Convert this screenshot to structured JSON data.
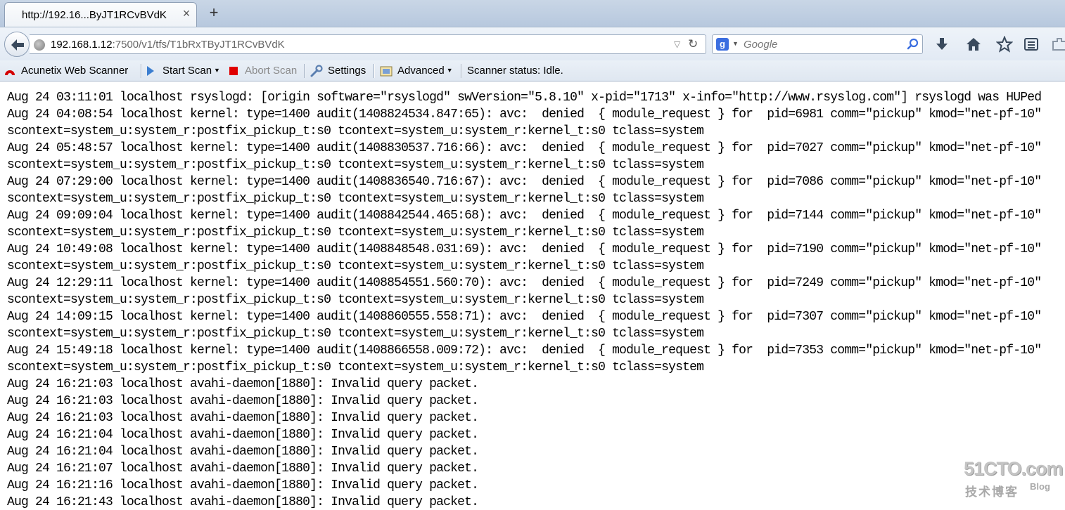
{
  "tab": {
    "title": "http://192.16...ByJT1RCvBVdK",
    "close_glyph": "×",
    "new_tab_glyph": "+"
  },
  "navbar": {
    "url_host": "192.168.1.12",
    "url_rest": ":7500/v1/tfs/T1bRxTByJT1RCvBVdK",
    "url_dropdown_glyph": "▽",
    "reload_glyph": "↻",
    "search_engine_letter": "g",
    "search_engine_drop_glyph": "▼",
    "search_placeholder": "Google",
    "icons": [
      "back-icon",
      "site-identity-icon",
      "dropdown-icon",
      "reload-icon",
      "google-icon",
      "search-icon",
      "download-icon",
      "home-icon",
      "bookmark-star-icon",
      "bookmarks-list-icon",
      "extension-icon"
    ]
  },
  "addon_toolbar": {
    "acunetix_label": "Acunetix Web Scanner",
    "start_scan_label": "Start Scan",
    "abort_scan_label": "Abort Scan",
    "settings_label": "Settings",
    "advanced_label": "Advanced",
    "dropdown_glyph": "▼",
    "status_text": "Scanner status: Idle."
  },
  "log_lines": [
    "Aug 24 03:11:01 localhost rsyslogd: [origin software=\"rsyslogd\" swVersion=\"5.8.10\" x-pid=\"1713\" x-info=\"http://www.rsyslog.com\"] rsyslogd was HUPed",
    "Aug 24 04:08:54 localhost kernel: type=1400 audit(1408824534.847:65): avc:  denied  { module_request } for  pid=6981 comm=\"pickup\" kmod=\"net-pf-10\"",
    "scontext=system_u:system_r:postfix_pickup_t:s0 tcontext=system_u:system_r:kernel_t:s0 tclass=system",
    "Aug 24 05:48:57 localhost kernel: type=1400 audit(1408830537.716:66): avc:  denied  { module_request } for  pid=7027 comm=\"pickup\" kmod=\"net-pf-10\"",
    "scontext=system_u:system_r:postfix_pickup_t:s0 tcontext=system_u:system_r:kernel_t:s0 tclass=system",
    "Aug 24 07:29:00 localhost kernel: type=1400 audit(1408836540.716:67): avc:  denied  { module_request } for  pid=7086 comm=\"pickup\" kmod=\"net-pf-10\"",
    "scontext=system_u:system_r:postfix_pickup_t:s0 tcontext=system_u:system_r:kernel_t:s0 tclass=system",
    "Aug 24 09:09:04 localhost kernel: type=1400 audit(1408842544.465:68): avc:  denied  { module_request } for  pid=7144 comm=\"pickup\" kmod=\"net-pf-10\"",
    "scontext=system_u:system_r:postfix_pickup_t:s0 tcontext=system_u:system_r:kernel_t:s0 tclass=system",
    "Aug 24 10:49:08 localhost kernel: type=1400 audit(1408848548.031:69): avc:  denied  { module_request } for  pid=7190 comm=\"pickup\" kmod=\"net-pf-10\"",
    "scontext=system_u:system_r:postfix_pickup_t:s0 tcontext=system_u:system_r:kernel_t:s0 tclass=system",
    "Aug 24 12:29:11 localhost kernel: type=1400 audit(1408854551.560:70): avc:  denied  { module_request } for  pid=7249 comm=\"pickup\" kmod=\"net-pf-10\"",
    "scontext=system_u:system_r:postfix_pickup_t:s0 tcontext=system_u:system_r:kernel_t:s0 tclass=system",
    "Aug 24 14:09:15 localhost kernel: type=1400 audit(1408860555.558:71): avc:  denied  { module_request } for  pid=7307 comm=\"pickup\" kmod=\"net-pf-10\"",
    "scontext=system_u:system_r:postfix_pickup_t:s0 tcontext=system_u:system_r:kernel_t:s0 tclass=system",
    "Aug 24 15:49:18 localhost kernel: type=1400 audit(1408866558.009:72): avc:  denied  { module_request } for  pid=7353 comm=\"pickup\" kmod=\"net-pf-10\"",
    "scontext=system_u:system_r:postfix_pickup_t:s0 tcontext=system_u:system_r:kernel_t:s0 tclass=system",
    "Aug 24 16:21:03 localhost avahi-daemon[1880]: Invalid query packet.",
    "Aug 24 16:21:03 localhost avahi-daemon[1880]: Invalid query packet.",
    "Aug 24 16:21:03 localhost avahi-daemon[1880]: Invalid query packet.",
    "Aug 24 16:21:04 localhost avahi-daemon[1880]: Invalid query packet.",
    "Aug 24 16:21:04 localhost avahi-daemon[1880]: Invalid query packet.",
    "Aug 24 16:21:07 localhost avahi-daemon[1880]: Invalid query packet.",
    "Aug 24 16:21:16 localhost avahi-daemon[1880]: Invalid query packet.",
    "Aug 24 16:21:43 localhost avahi-daemon[1880]: Invalid query packet."
  ],
  "watermark": {
    "main": "51CTO.com",
    "sub": "技术博客",
    "blog": "Blog"
  },
  "colors": {
    "chrome_blue": "#c9d6e6",
    "accent": "#3b6ee0",
    "stop_red": "#e00000"
  }
}
